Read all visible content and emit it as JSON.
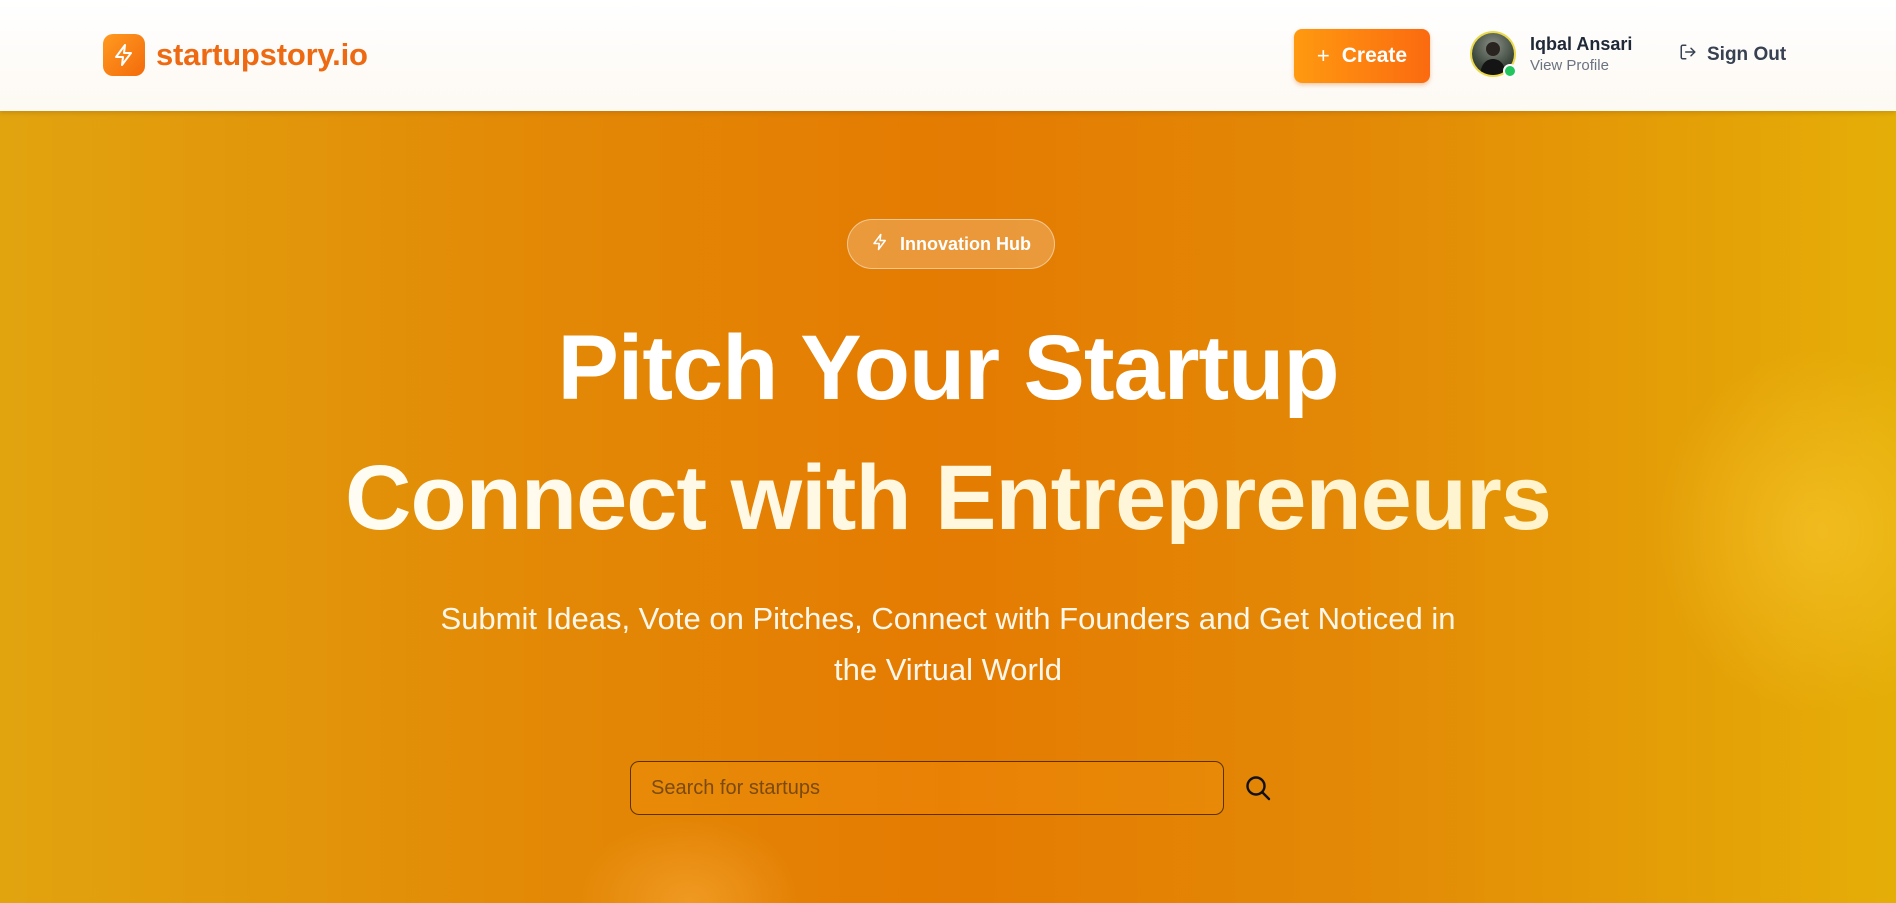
{
  "navbar": {
    "brand": "startupstory.io",
    "brand_icon": "lightning-icon",
    "create_label": "Create",
    "create_icon": "plus-icon",
    "user": {
      "name": "Iqbal Ansari",
      "profile_link": "View Profile",
      "status": "online"
    },
    "signout_label": "Sign Out",
    "signout_icon": "logout-icon"
  },
  "hero": {
    "badge_label": "Innovation Hub",
    "badge_icon": "lightning-icon",
    "headline_line1": "Pitch Your Startup",
    "headline_line2": "Connect with Entrepreneurs",
    "subheading": "Submit Ideas, Vote on Pitches, Connect with Founders and Get Noticed in the Virtual World",
    "search": {
      "placeholder": "Search for startups",
      "value": "",
      "icon": "search-icon"
    }
  },
  "colors": {
    "brand": "#ee6a12",
    "button_gradient": [
      "#ff9a10",
      "#fb6a10"
    ],
    "hero_gradient": [
      "#e1a40f",
      "#e47b02",
      "#e5ae07"
    ],
    "online": "#22c55e"
  }
}
